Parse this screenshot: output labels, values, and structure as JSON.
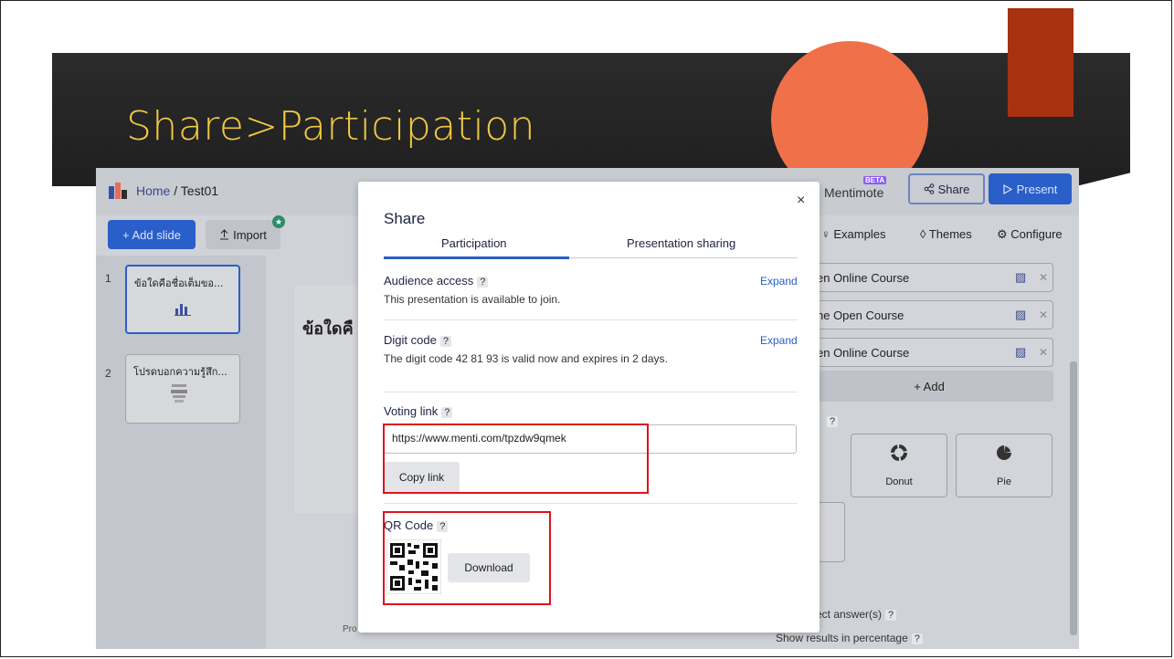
{
  "slide": {
    "title": "Share>Participation"
  },
  "app": {
    "breadcrumb_home": "Home",
    "breadcrumb_sep": " / ",
    "breadcrumb_current": "Test01",
    "mentimote": "Mentimote",
    "beta": "BETA",
    "share_label": "Share",
    "present_label": "Present",
    "add_slide": "+ Add slide",
    "import": "Import",
    "examples": "Examples",
    "themes": "Themes",
    "configure": "Configure",
    "slides": [
      {
        "num": "1",
        "title": "ข้อใดคือชื่อเต็มขอ..."
      },
      {
        "num": "2",
        "title": "โปรดบอกความรู้สึก..."
      }
    ],
    "canvas_title": "ข้อใดคื",
    "footer_text": "Pro",
    "options": [
      "en Online Course",
      "ne Open Course",
      "en Online Course"
    ],
    "add_option": "+ Add",
    "chart_types": [
      "Donut",
      "Pie"
    ],
    "correct_answer": "rrect answer(s)",
    "show_percentage": "Show results in percentage",
    "help": "?"
  },
  "modal": {
    "title": "Share",
    "close": "×",
    "tabs": [
      "Participation",
      "Presentation sharing"
    ],
    "audience_title": "Audience access",
    "audience_text": "This presentation is available to join.",
    "expand": "Expand",
    "digit_title": "Digit code",
    "digit_text": "The digit code 42 81 93 is valid now and expires in 2 days.",
    "voting_title": "Voting link",
    "voting_url": "https://www.menti.com/tpzdw9qmek",
    "copy_link": "Copy link",
    "qr_title": "QR Code",
    "download": "Download",
    "help": "?"
  },
  "colors": {
    "accent": "#2a5ec8",
    "title": "#f1c843",
    "circle": "#f07049",
    "block": "#a8310f",
    "highlight": "#e0121c"
  },
  "icons": [
    "share-icon",
    "play-icon",
    "upload-icon",
    "bulb-icon",
    "palette-icon",
    "gear-icon",
    "image-icon",
    "close-icon",
    "bar-chart-icon",
    "donut-icon",
    "pie-icon",
    "qr-code-icon"
  ]
}
